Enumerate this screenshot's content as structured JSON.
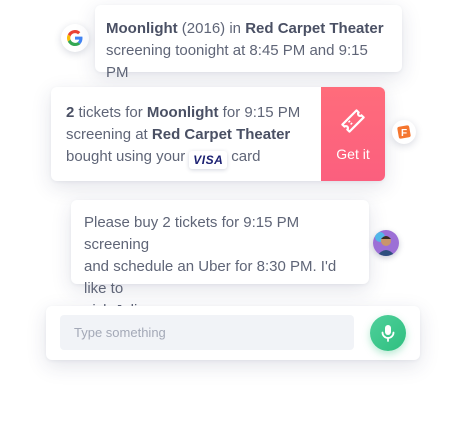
{
  "messages": {
    "google": {
      "icon": "google-icon",
      "movie": "Moonlight",
      "year": " (2016) in ",
      "theater": "Red Carpet Theater",
      "line2": "screening toonight at 8:45 PM and 9:15 PM"
    },
    "ticket": {
      "icon": "fandango-icon",
      "count": "2",
      "text_a": " tickets for ",
      "movie": "Moonlight",
      "text_b": " for 9:15 PM",
      "text_c": "screening at ",
      "theater": "Red Carpet Theater",
      "text_d": "bought using your",
      "visa": "VISA",
      "text_e": "card",
      "action_label": "Get it",
      "action_icon": "ticket-icon",
      "action_color": "#fd6680"
    },
    "user": {
      "avatar": "user-avatar",
      "line1": "Please buy 2 tickets for 9:15 PM screening",
      "line2": "and schedule an Uber for 8:30 PM. I'd like to",
      "line3": "pick Julia up on my way."
    }
  },
  "composer": {
    "placeholder": "Type something",
    "mic_icon": "microphone-icon",
    "mic_color": "#3cc98d"
  }
}
